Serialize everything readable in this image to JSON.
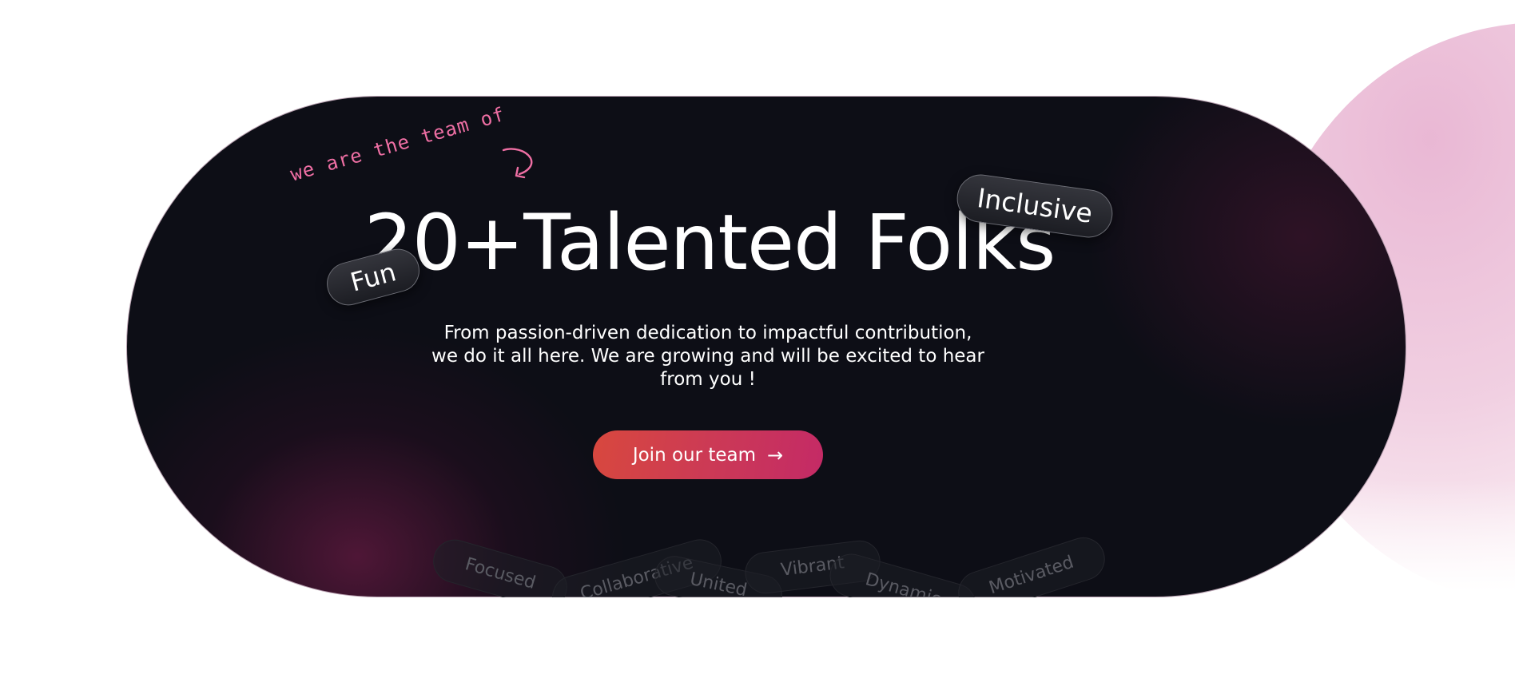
{
  "hero": {
    "handwritten_note": "we are the team of",
    "headline": "20+Talented Folks",
    "tag_fun": "Fun",
    "tag_inclusive": "Inclusive",
    "subtext": "From passion-driven dedication to impactful contribution, we do it all here. We are growing and will be excited to hear from you !",
    "cta_label": "Join our team",
    "cta_arrow": "→",
    "traits": [
      "Focused",
      "Collaborative",
      "United",
      "Vibrant",
      "Dynamic",
      "Motivated"
    ]
  },
  "colors": {
    "hero_background": "#0d0e16",
    "accent_pink": "#ef6fa4",
    "cta_start": "#d8483e",
    "cta_end": "#c42a66",
    "blob": "#e8b4d2"
  },
  "icons": {
    "cta_icon": "arrow-right-icon",
    "doodle_icon": "curly-arrow-icon"
  }
}
